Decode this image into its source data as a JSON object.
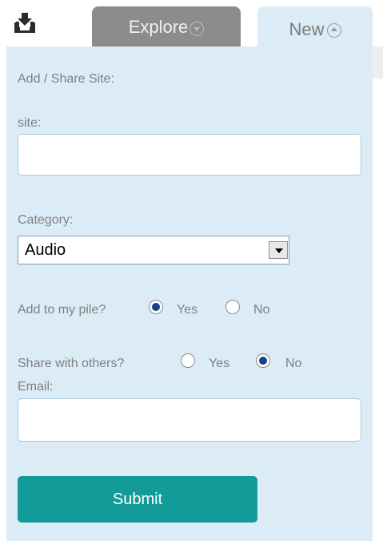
{
  "tabs": {
    "explore_label": "Explore",
    "new_label": "New"
  },
  "form": {
    "heading": "Add / Share Site:",
    "site_label": "site:",
    "site_value": "",
    "category_label": "Category:",
    "category_selected": "Audio",
    "pile_question": "Add to my pile?",
    "pile_yes": "Yes",
    "pile_no": "No",
    "pile_selected": "Yes",
    "share_question": "Share with others?",
    "share_yes": "Yes",
    "share_no": "No",
    "share_selected": "No",
    "email_label": "Email:",
    "email_value": "",
    "submit_label": "Submit"
  },
  "colors": {
    "panel_bg": "#dcecf6",
    "explore_tab_bg": "#8c8c8c",
    "submit_bg": "#139b99",
    "radio_checked": "#1a3f8a"
  },
  "icons": {
    "logo": "download-tray-icon",
    "explore_tab": "chevron-down-circle-icon",
    "new_tab": "chevron-up-circle-icon"
  }
}
